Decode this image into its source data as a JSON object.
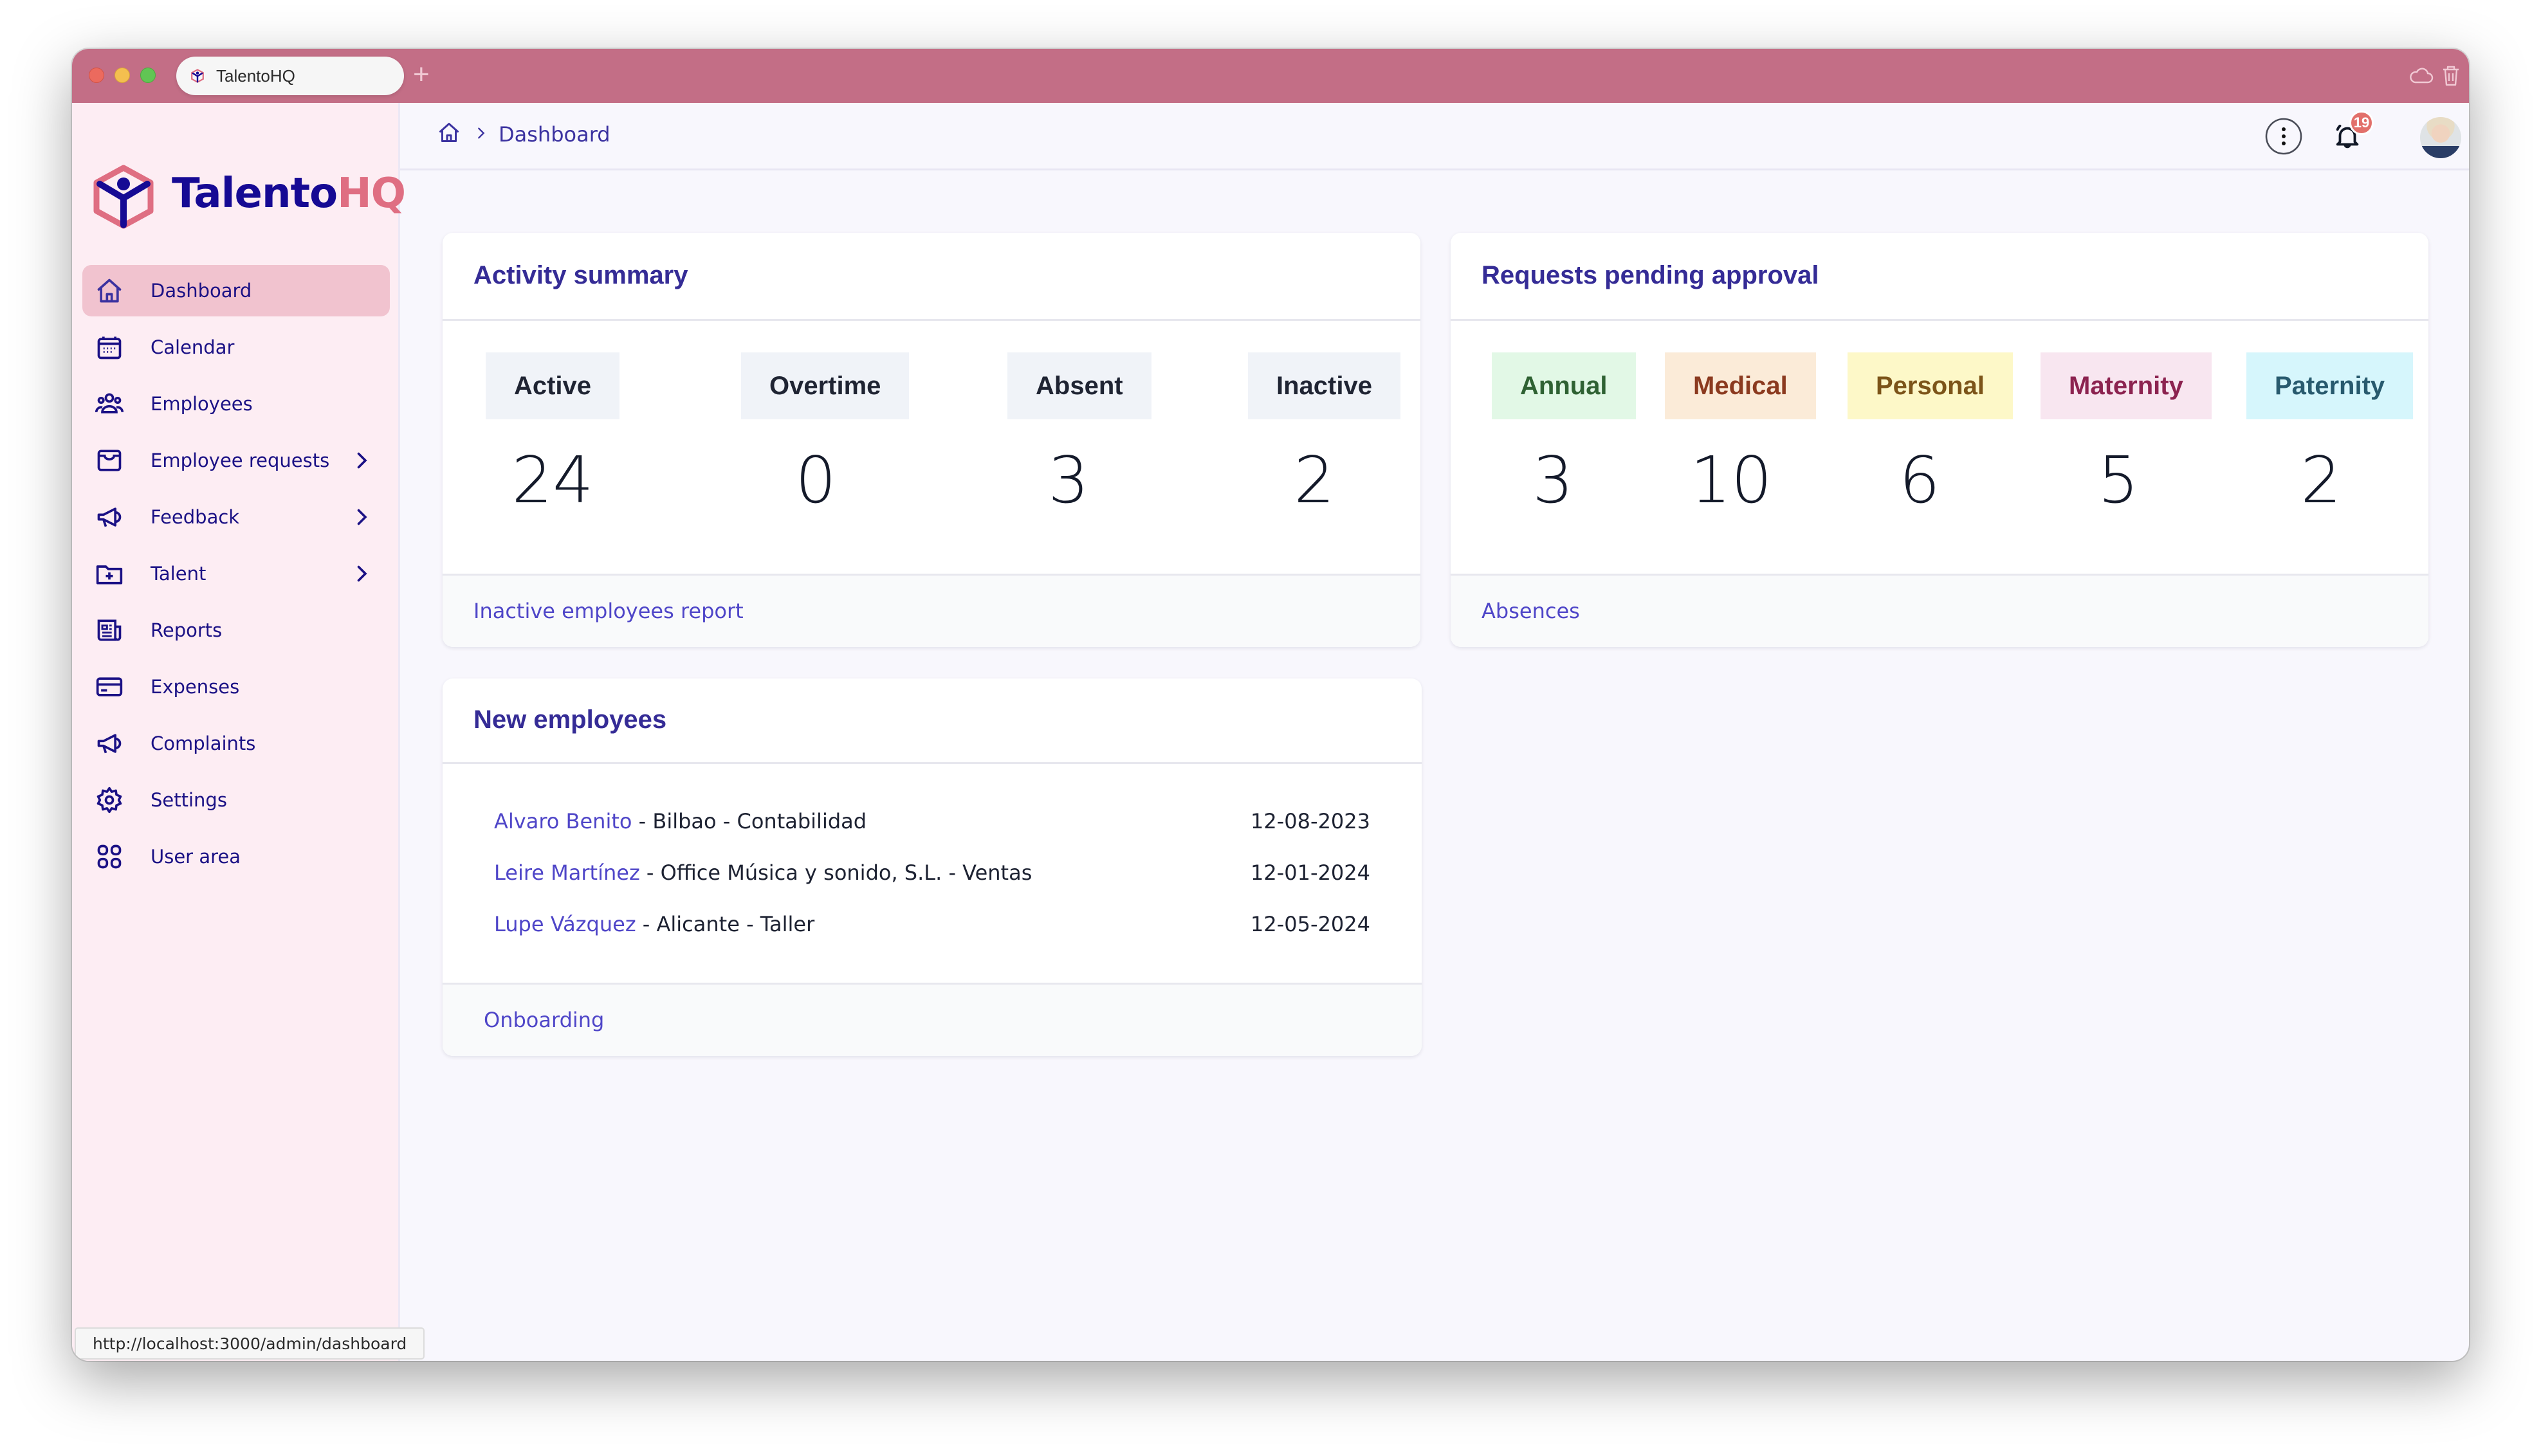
{
  "browser": {
    "tab_title": "TalentoHQ",
    "new_tab_icon": "plus-icon",
    "toolbar_icons": [
      "cloud-icon",
      "trash-icon"
    ],
    "status_url": "http://localhost:3000/admin/dashboard"
  },
  "brand": {
    "name_part1": "Talento",
    "name_part2": "HQ",
    "colors": {
      "primary": "#160a94",
      "accent": "#df6e82",
      "tabbar": "#c36e86"
    }
  },
  "sidebar": {
    "items": [
      {
        "label": "Dashboard",
        "icon": "home-icon",
        "active": true,
        "has_submenu": false
      },
      {
        "label": "Calendar",
        "icon": "calendar-icon",
        "active": false,
        "has_submenu": false
      },
      {
        "label": "Employees",
        "icon": "users-icon",
        "active": false,
        "has_submenu": false
      },
      {
        "label": "Employee requests",
        "icon": "inbox-icon",
        "active": false,
        "has_submenu": true
      },
      {
        "label": "Feedback",
        "icon": "megaphone-icon",
        "active": false,
        "has_submenu": true
      },
      {
        "label": "Talent",
        "icon": "folder-plus-icon",
        "active": false,
        "has_submenu": true
      },
      {
        "label": "Reports",
        "icon": "newspaper-icon",
        "active": false,
        "has_submenu": false
      },
      {
        "label": "Expenses",
        "icon": "credit-card-icon",
        "active": false,
        "has_submenu": false
      },
      {
        "label": "Complaints",
        "icon": "megaphone-icon",
        "active": false,
        "has_submenu": false
      },
      {
        "label": "Settings",
        "icon": "gear-icon",
        "active": false,
        "has_submenu": false
      },
      {
        "label": "User area",
        "icon": "grid-icon",
        "active": false,
        "has_submenu": false
      }
    ]
  },
  "header": {
    "breadcrumb": [
      "Dashboard"
    ],
    "notification_count": "19"
  },
  "activity_summary": {
    "title": "Activity summary",
    "stats": [
      {
        "label": "Active",
        "value": "24"
      },
      {
        "label": "Overtime",
        "value": "0"
      },
      {
        "label": "Absent",
        "value": "3"
      },
      {
        "label": "Inactive",
        "value": "2"
      }
    ],
    "footer_link": "Inactive employees report"
  },
  "requests_pending": {
    "title": "Requests pending approval",
    "stats": [
      {
        "label": "Annual",
        "value": "3",
        "bg": "#e2f8e6",
        "fg": "#2f6233"
      },
      {
        "label": "Medical",
        "value": "10",
        "bg": "#fbebd8",
        "fg": "#8b3a1f"
      },
      {
        "label": "Personal",
        "value": "6",
        "bg": "#fdf8c8",
        "fg": "#7c5419"
      },
      {
        "label": "Maternity",
        "value": "5",
        "bg": "#f8e6f0",
        "fg": "#8c2350"
      },
      {
        "label": "Paternity",
        "value": "2",
        "bg": "#d6f6fc",
        "fg": "#285a6e"
      }
    ],
    "footer_link": "Absences"
  },
  "new_employees": {
    "title": "New employees",
    "rows": [
      {
        "name": "Alvaro Benito",
        "details": " - Bilbao - Contabilidad",
        "date": "12-08-2023"
      },
      {
        "name": "Leire Martínez",
        "details": " - Office Música y sonido, S.L. - Ventas",
        "date": "12-01-2024"
      },
      {
        "name": "Lupe Vázquez",
        "details": " - Alicante - Taller",
        "date": "12-05-2024"
      }
    ],
    "footer_link": "Onboarding"
  }
}
